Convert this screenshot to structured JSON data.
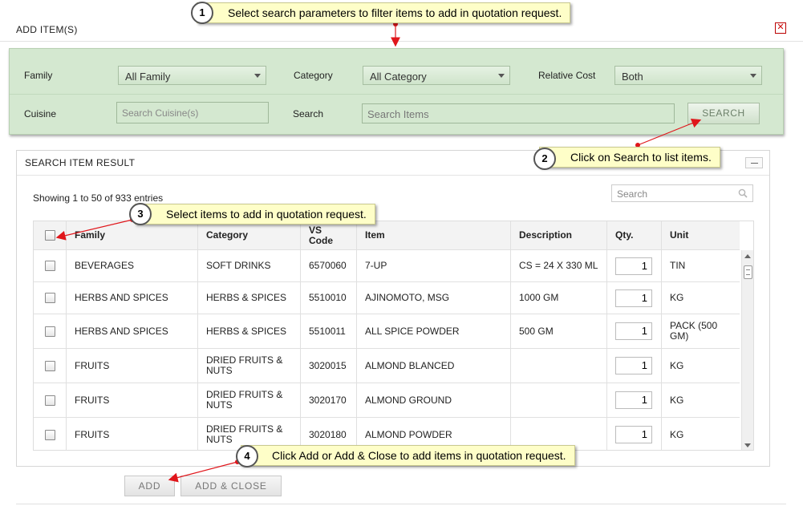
{
  "dialog": {
    "title": "ADD  ITEM(S)",
    "close": "✕"
  },
  "filters": {
    "family_label": "Family",
    "family_value": "All Family",
    "category_label": "Category",
    "category_value": "All Category",
    "relative_cost_label": "Relative Cost",
    "relative_cost_value": "Both",
    "cuisine_label": "Cuisine",
    "cuisine_placeholder": "Search Cuisine(s)",
    "search_label": "Search",
    "search_placeholder": "Search Items",
    "search_button": "SEARCH"
  },
  "result": {
    "title": "SEARCH ITEM RESULT",
    "showing": "Showing 1 to 50 of 933 entries",
    "search_placeholder": "Search",
    "columns": {
      "family": "Family",
      "category": "Category",
      "vs_code": "VS Code",
      "item": "Item",
      "description": "Description",
      "qty": "Qty.",
      "unit": "Unit"
    },
    "rows": [
      {
        "family": "BEVERAGES",
        "category": "SOFT DRINKS",
        "vs_code": "6570060",
        "item": "7-UP",
        "description": "CS = 24 X 330 ML",
        "qty": "1",
        "unit": "TIN"
      },
      {
        "family": "HERBS AND SPICES",
        "category": "HERBS & SPICES",
        "vs_code": "5510010",
        "item": "AJINOMOTO, MSG",
        "description": "1000 GM",
        "qty": "1",
        "unit": "KG"
      },
      {
        "family": "HERBS AND SPICES",
        "category": "HERBS & SPICES",
        "vs_code": "5510011",
        "item": "ALL SPICE POWDER",
        "description": "500 GM",
        "qty": "1",
        "unit": "PACK (500 GM)"
      },
      {
        "family": "FRUITS",
        "category": "DRIED FRUITS & NUTS",
        "vs_code": "3020015",
        "item": "ALMOND BLANCED",
        "description": "",
        "qty": "1",
        "unit": "KG"
      },
      {
        "family": "FRUITS",
        "category": "DRIED FRUITS & NUTS",
        "vs_code": "3020170",
        "item": "ALMOND GROUND",
        "description": "",
        "qty": "1",
        "unit": "KG"
      },
      {
        "family": "FRUITS",
        "category": "DRIED FRUITS & NUTS",
        "vs_code": "3020180",
        "item": "ALMOND POWDER",
        "description": "",
        "qty": "1",
        "unit": "KG"
      }
    ]
  },
  "buttons": {
    "add": "ADD",
    "add_close": "ADD & CLOSE"
  },
  "callouts": [
    {
      "num": "1",
      "text": "Select search parameters to filter items to add in quotation request."
    },
    {
      "num": "2",
      "text": "Click on Search to list items."
    },
    {
      "num": "3",
      "text": "Select items to add in quotation request."
    },
    {
      "num": "4",
      "text": "Click Add or Add & Close to add items in quotation request."
    }
  ],
  "colors": {
    "filter_bg": "#d4e8d0",
    "callout_bg": "#fefec8",
    "arrow": "#e0161b"
  }
}
